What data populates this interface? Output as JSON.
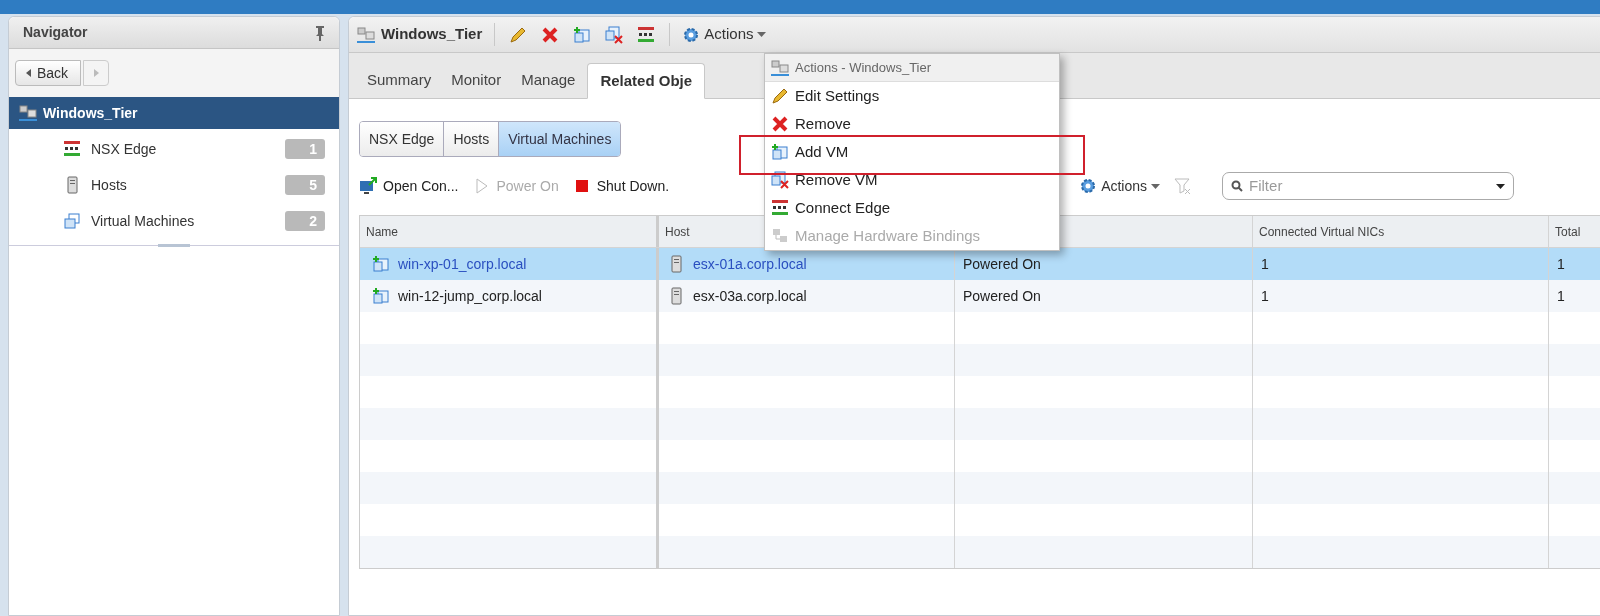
{
  "navigator": {
    "title": "Navigator",
    "back": "Back",
    "root": {
      "label": "Windows_Tier",
      "selected": true
    },
    "items": [
      {
        "kind": "edge",
        "label": "NSX Edge",
        "count": "1"
      },
      {
        "kind": "host",
        "label": "Hosts",
        "count": "5"
      },
      {
        "kind": "vm",
        "label": "Virtual Machines",
        "count": "2"
      }
    ]
  },
  "object_toolbar": {
    "title": "Windows_Tier",
    "actions": "Actions"
  },
  "tabs": [
    {
      "label": "Summary",
      "selected": false
    },
    {
      "label": "Monitor",
      "selected": false
    },
    {
      "label": "Manage",
      "selected": false
    },
    {
      "label": "Related Obje",
      "selected": true
    }
  ],
  "sub_tabs": [
    {
      "label": "NSX Edge",
      "selected": false
    },
    {
      "label": "Hosts",
      "selected": false
    },
    {
      "label": "Virtual Machines",
      "selected": true
    }
  ],
  "grid_toolbar": {
    "buttons": [
      {
        "kind": "console",
        "label": "Open Con...",
        "disabled": false
      },
      {
        "kind": "power",
        "label": "Power On",
        "disabled": true
      },
      {
        "kind": "stop",
        "label": "Shut Down.",
        "disabled": false
      }
    ],
    "actions": "Actions",
    "filter": {
      "placeholder": "Filter"
    }
  },
  "table": {
    "columns": [
      "Name",
      "Host",
      "",
      "Connected Virtual NICs",
      "Total"
    ],
    "rows": [
      {
        "selected": true,
        "cells": [
          "win-xp-01_corp.local",
          "esx-01a.corp.local",
          "Powered On",
          "1",
          "1"
        ]
      },
      {
        "selected": false,
        "cells": [
          "win-12-jump_corp.local",
          "esx-03a.corp.local",
          "Powered On",
          "1",
          "1"
        ]
      }
    ]
  },
  "menu": {
    "title": "Actions - Windows_Tier",
    "items": [
      {
        "kind": "edit",
        "label": "Edit Settings",
        "disabled": false,
        "highlighted": false
      },
      {
        "kind": "remove",
        "label": "Remove",
        "disabled": false,
        "highlighted": false
      },
      {
        "kind": "add-vm",
        "label": "Add VM",
        "disabled": false,
        "highlighted": true
      },
      {
        "kind": "remove-vm",
        "label": "Remove VM",
        "disabled": false,
        "highlighted": false
      },
      {
        "kind": "edge",
        "label": "Connect Edge",
        "disabled": false,
        "highlighted": false
      },
      {
        "kind": "bindings",
        "label": "Manage Hardware Bindings",
        "disabled": true,
        "highlighted": false
      }
    ]
  }
}
